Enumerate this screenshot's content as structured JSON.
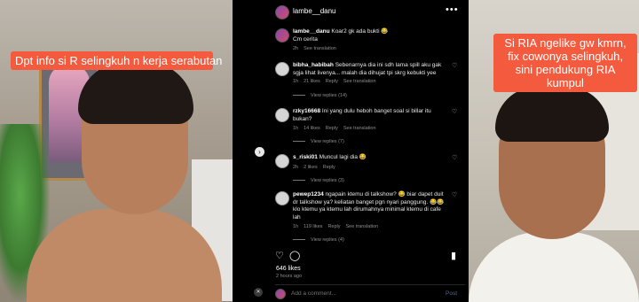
{
  "left": {
    "caption": "Dpt info si R selingkuh n kerja serabutan"
  },
  "right": {
    "caption": "Si RIA ngelike gw kmrn, fix cowonya selingkuh, sini pendukung RIA kumpul"
  },
  "post": {
    "username": "lambe__danu",
    "caption_user": "lambe__danu",
    "caption_text": "Koar2 gk ada bukti 😂",
    "caption_line2": "Cm cerita",
    "caption_time": "2h",
    "caption_translate": "See translation",
    "likes": "646 likes",
    "time_ago": "2 hours ago",
    "add_comment_placeholder": "Add a comment...",
    "post_label": "Post"
  },
  "comments": [
    {
      "user": "bibha_habibah",
      "text": "Sebenarnya dia ini sdh lama spill aku gak sgja lihat livenya... malah dia dihujat tpi skrg kebukti yee",
      "time": "1h",
      "likes": "21 likes",
      "reply": "Reply",
      "translate": "See translation",
      "view_replies": "View replies (14)"
    },
    {
      "user": "rzky16668",
      "text": "Ini yang dulu heboh banget soal si billar itu bukan?",
      "time": "1h",
      "likes": "14 likes",
      "reply": "Reply",
      "translate": "See translation",
      "view_replies": "View replies (7)"
    },
    {
      "user": "s_riski01",
      "text": "Muncul lagi dia 😂",
      "time": "2h",
      "likes": "2 likes",
      "reply": "Reply",
      "translate": "",
      "view_replies": "View replies (3)"
    },
    {
      "user": "pewep1234",
      "text": "ngapain ktemu di talkshow? 😂 biar dapet duit dr talkshow ya? keliatan banget pgn nyari panggung. 😂😂 klo ktemu ya ktemu lah dirumahnya minimal ktemu di cafe lah",
      "time": "1h",
      "likes": "119 likes",
      "reply": "Reply",
      "translate": "See translation",
      "view_replies": "View replies (4)"
    }
  ],
  "icons": {
    "more": "more-horizontal-icon",
    "heart": "heart-icon",
    "comment": "comment-icon",
    "bookmark": "bookmark-icon",
    "next": "chevron-right-icon",
    "mute": "mute-icon"
  }
}
